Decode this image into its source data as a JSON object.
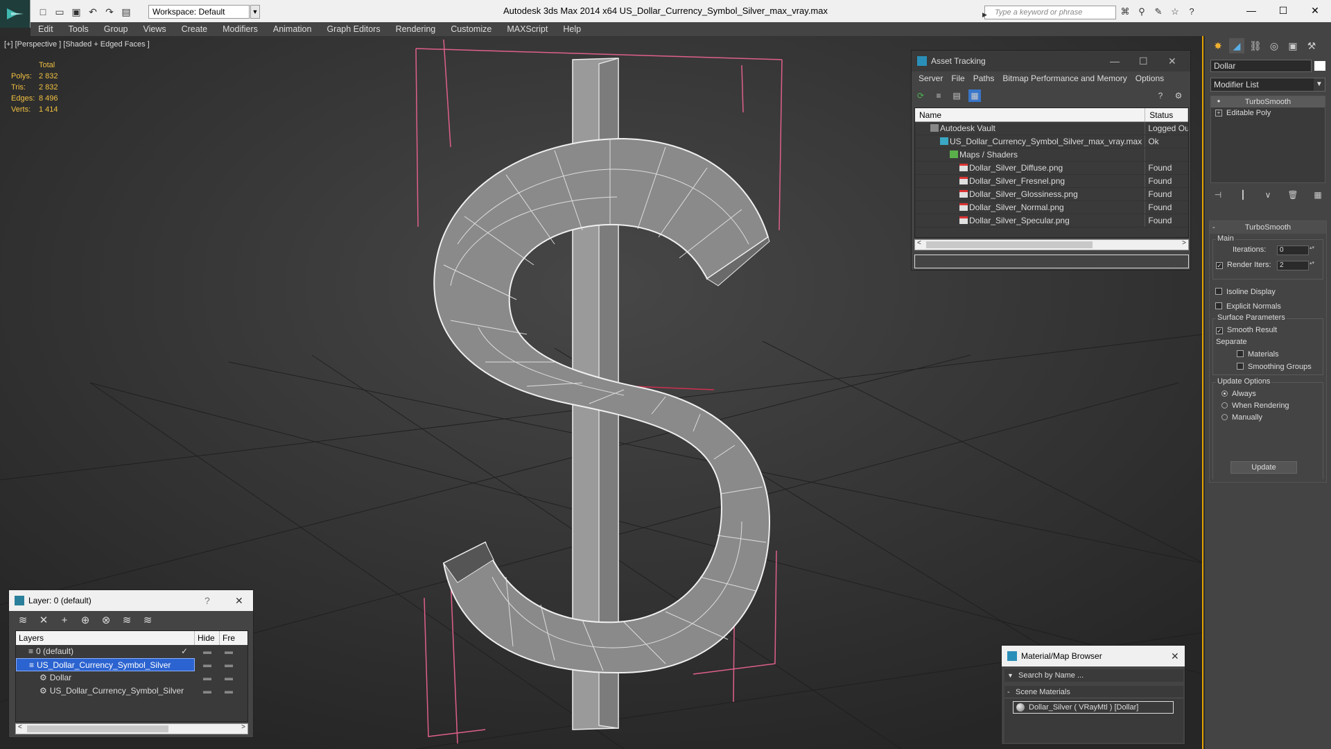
{
  "app": {
    "title": "Autodesk 3ds Max  2014 x64      US_Dollar_Currency_Symbol_Silver_max_vray.max",
    "workspace": "Workspace: Default",
    "search_placeholder": "Type a keyword or phrase"
  },
  "menu": [
    "Edit",
    "Tools",
    "Group",
    "Views",
    "Create",
    "Modifiers",
    "Animation",
    "Graph Editors",
    "Rendering",
    "Customize",
    "MAXScript",
    "Help"
  ],
  "viewport": {
    "label": "[+] [Perspective ] [Shaded + Edged Faces ]",
    "stats_header": "Total",
    "stats": [
      {
        "k": "Polys:",
        "v": "2 832"
      },
      {
        "k": "Tris:",
        "v": "2 832"
      },
      {
        "k": "Edges:",
        "v": "8 496"
      },
      {
        "k": "Verts:",
        "v": "1 414"
      }
    ]
  },
  "asset_tracking": {
    "title": "Asset Tracking",
    "menu": [
      "Server",
      "File",
      "Paths",
      "Bitmap Performance and Memory",
      "Options"
    ],
    "columns": [
      "Name",
      "Status"
    ],
    "rows": [
      {
        "name": "Autodesk Vault",
        "status": "Logged Ou",
        "icon": "vault"
      },
      {
        "name": "US_Dollar_Currency_Symbol_Silver_max_vray.max",
        "status": "Ok",
        "icon": "max"
      },
      {
        "name": "Maps / Shaders",
        "status": "",
        "icon": "folder"
      },
      {
        "name": "Dollar_Silver_Diffuse.png",
        "status": "Found",
        "icon": "png"
      },
      {
        "name": "Dollar_Silver_Fresnel.png",
        "status": "Found",
        "icon": "png"
      },
      {
        "name": "Dollar_Silver_Glossiness.png",
        "status": "Found",
        "icon": "png"
      },
      {
        "name": "Dollar_Silver_Normal.png",
        "status": "Found",
        "icon": "png"
      },
      {
        "name": "Dollar_Silver_Specular.png",
        "status": "Found",
        "icon": "png"
      }
    ]
  },
  "command_panel": {
    "object_name": "Dollar",
    "modifier_list": "Modifier List",
    "stack": [
      "TurboSmooth",
      "Editable Poly"
    ],
    "turbosmooth": {
      "title": "TurboSmooth",
      "main_label": "Main",
      "iterations_label": "Iterations:",
      "iterations_value": "0",
      "render_iters_label": "Render Iters:",
      "render_iters_value": "2",
      "isoline_label": "Isoline Display",
      "explicit_normals_label": "Explicit Normals",
      "surface_params_label": "Surface Parameters",
      "smooth_result_label": "Smooth Result",
      "separate_label": "Separate",
      "materials_label": "Materials",
      "smoothing_groups_label": "Smoothing Groups",
      "update_options_label": "Update Options",
      "always_label": "Always",
      "when_rendering_label": "When Rendering",
      "manually_label": "Manually",
      "update_button": "Update"
    }
  },
  "layer_window": {
    "title": "Layer: 0 (default)",
    "help": "?",
    "columns": [
      "Layers",
      "Hide",
      "Fre"
    ],
    "rows": [
      {
        "name": "0 (default)",
        "indent": 1
      },
      {
        "name": "US_Dollar_Currency_Symbol_Silver",
        "indent": 1
      },
      {
        "name": "Dollar",
        "indent": 2
      },
      {
        "name": "US_Dollar_Currency_Symbol_Silver",
        "indent": 2
      }
    ]
  },
  "material_browser": {
    "title": "Material/Map Browser",
    "search": "Search by Name ...",
    "category": "Scene Materials",
    "item": "Dollar_Silver  ( VRayMtl ) [Dollar]"
  }
}
